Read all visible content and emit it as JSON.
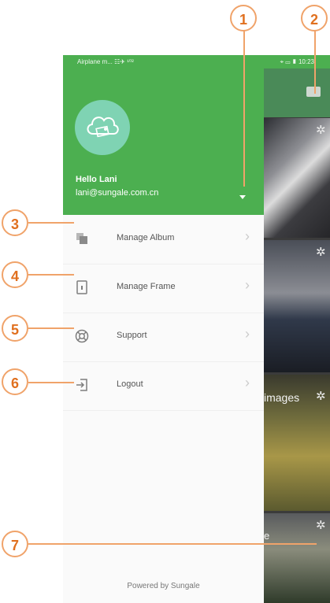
{
  "status_bar": {
    "left": "Airplane m... ☷✈ ¹⁰²",
    "right": "⌖ ▭ ▮ 10:23"
  },
  "user": {
    "greeting": "Hello Lani",
    "email": "lani@sungale.com.cn"
  },
  "menu": [
    {
      "label": "Manage Album",
      "icon": "album-icon"
    },
    {
      "label": "Manage Frame",
      "icon": "frame-icon"
    },
    {
      "label": "Support",
      "icon": "support-icon"
    },
    {
      "label": "Logout",
      "icon": "logout-icon"
    }
  ],
  "footer": {
    "powered_by": "Powered by Sungale"
  },
  "background_app": {
    "images_label": "images",
    "partial_label": "e"
  },
  "callouts": [
    "1",
    "2",
    "3",
    "4",
    "5",
    "6",
    "7"
  ],
  "colors": {
    "header_green": "#4caf50",
    "callout_orange": "#f0a36a",
    "callout_text": "#e0701f"
  }
}
